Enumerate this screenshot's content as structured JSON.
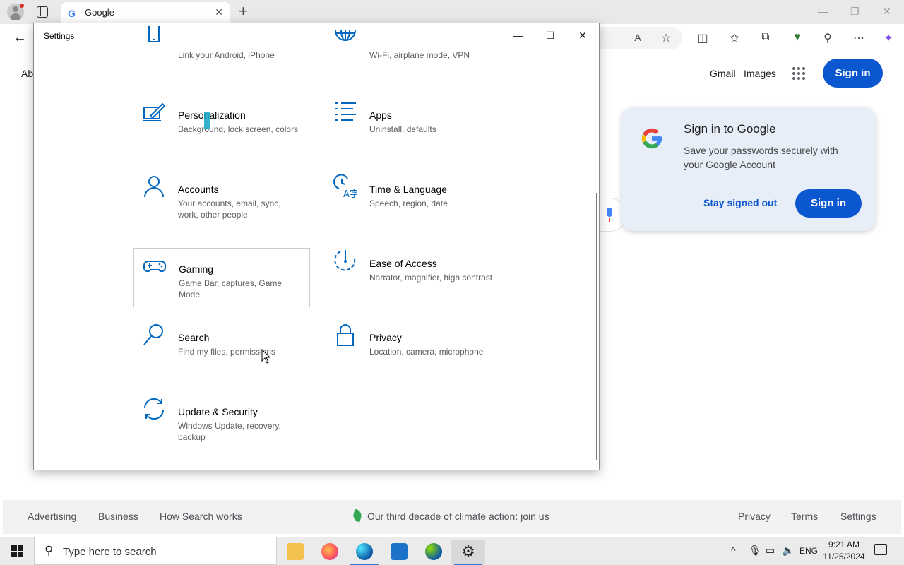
{
  "browser": {
    "tab_title": "Google",
    "tab_favicon": "G",
    "tab_close": "✕",
    "new_tab": "+",
    "win_min": "—",
    "win_restore": "❐",
    "win_close": "✕",
    "back": "←",
    "toolbar_icons": [
      "read-aloud-icon",
      "favorite-icon",
      "split-screen-icon",
      "favorites-icon",
      "collections-icon",
      "browser-essentials-icon",
      "extensions-icon",
      "more-icon",
      "copilot-icon"
    ]
  },
  "google": {
    "about": "Ab",
    "gmail": "Gmail",
    "images": "Images",
    "signin": "Sign in",
    "popup": {
      "title": "Sign in to Google",
      "body": "Save your passwords securely with your Google Account",
      "stay_signed_out": "Stay signed out",
      "signin": "Sign in"
    },
    "footer": {
      "advertising": "Advertising",
      "business": "Business",
      "how_search_works": "How Search works",
      "climate": "Our third decade of climate action: join us",
      "privacy": "Privacy",
      "terms": "Terms",
      "settings": "Settings"
    },
    "colors": {
      "blue": "#0b57d0",
      "popup_bg": "#e8eef8"
    }
  },
  "settings": {
    "title": "Settings",
    "controls": {
      "minimize": "—",
      "maximize": "☐",
      "close": "✕"
    },
    "items": [
      {
        "name": "",
        "desc": "Link your Android, iPhone",
        "icon": "phone-icon"
      },
      {
        "name": "",
        "desc": "Wi-Fi, airplane mode, VPN",
        "icon": "globe-icon"
      },
      {
        "name": "Personalization",
        "desc": "Background, lock screen, colors",
        "icon": "paint-icon"
      },
      {
        "name": "Apps",
        "desc": "Uninstall, defaults",
        "icon": "apps-list-icon"
      },
      {
        "name": "Accounts",
        "desc": "Your accounts, email, sync, work, other people",
        "icon": "person-icon"
      },
      {
        "name": "Time & Language",
        "desc": "Speech, region, date",
        "icon": "time-language-icon"
      },
      {
        "name": "Gaming",
        "desc": "Game Bar, captures, Game Mode",
        "icon": "gamepad-icon"
      },
      {
        "name": "Ease of Access",
        "desc": "Narrator, magnifier, high contrast",
        "icon": "ease-of-access-icon"
      },
      {
        "name": "Search",
        "desc": "Find my files, permissions",
        "icon": "search-icon"
      },
      {
        "name": "Privacy",
        "desc": "Location, camera, microphone",
        "icon": "lock-icon"
      },
      {
        "name": "Update & Security",
        "desc": "Windows Update, recovery, backup",
        "icon": "sync-icon"
      }
    ],
    "accent": "#0067c0"
  },
  "taskbar": {
    "search_placeholder": "Type here to search",
    "apps": [
      "file-explorer-icon",
      "firefox-icon",
      "edge-icon",
      "remote-desktop-icon",
      "edge-dev-icon",
      "settings-gear-icon"
    ],
    "tray_language": "ENG",
    "time": "9:21 AM",
    "date": "11/25/2024"
  }
}
